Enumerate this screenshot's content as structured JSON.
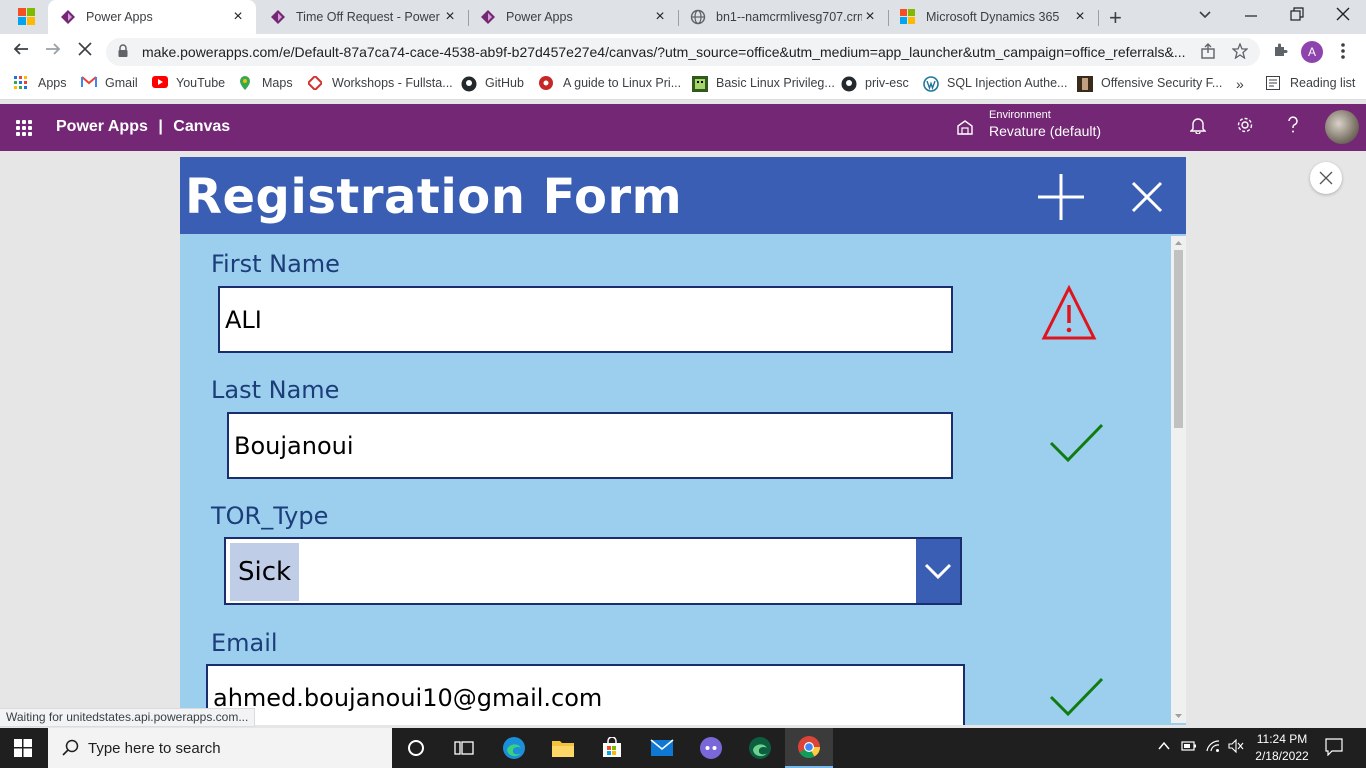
{
  "browser": {
    "tabs": [
      {
        "title": "Power Apps",
        "active": true
      },
      {
        "title": "Time Off Request - Power A",
        "active": false
      },
      {
        "title": "Power Apps",
        "active": false
      },
      {
        "title": "bn1--namcrmlivesg707.crm",
        "active": false
      },
      {
        "title": "Microsoft Dynamics 365",
        "active": false
      }
    ],
    "url": "make.powerapps.com/e/Default-87a7ca74-cace-4538-ab9f-b27d457e27e4/canvas/?utm_source=office&utm_medium=app_launcher&utm_campaign=office_referrals&...",
    "profile_initial": "A",
    "bookmarks": [
      "Apps",
      "Gmail",
      "YouTube",
      "Maps",
      "Workshops - Fullsta...",
      "GitHub",
      "A guide to Linux Pri...",
      "Basic Linux Privileg...",
      "priv-esc",
      "SQL Injection Authe...",
      "Offensive Security F..."
    ],
    "bookmarks_overflow": "»",
    "reading_list": "Reading list",
    "status_text": "Waiting for unitedstates.api.powerapps.com..."
  },
  "powerapps": {
    "brand": "Power Apps",
    "separator": "|",
    "mode": "Canvas",
    "environment_label": "Environment",
    "environment_name": "Revature (default)"
  },
  "form": {
    "title": "Registration Form",
    "fields": {
      "first_name": {
        "label": "First Name",
        "value": "ALI",
        "status": "warning"
      },
      "last_name": {
        "label": "Last Name",
        "value": "Boujanoui",
        "status": "valid"
      },
      "tor_type": {
        "label": "TOR_Type",
        "value": "Sick"
      },
      "email": {
        "label": "Email",
        "value": "ahmed.boujanoui10@gmail.com",
        "status": "valid"
      }
    }
  },
  "taskbar": {
    "search_placeholder": "Type here to search",
    "time": "11:24 PM",
    "date": "2/18/2022"
  },
  "colors": {
    "powerapps_purple": "#742774",
    "form_header": "#3a5eb3",
    "form_body": "#9bcfed",
    "label_text": "#1c3d7a",
    "warning_red": "#e0141e",
    "valid_green": "#107c10"
  },
  "icons": [
    "windows-logo",
    "powerapps-icon",
    "globe-icon",
    "ms365-icon",
    "plus-icon",
    "close-icon",
    "back-arrow-icon",
    "forward-arrow-icon",
    "reload-icon",
    "lock-icon",
    "share-icon",
    "star-icon",
    "extensions-icon",
    "waffle-icon",
    "environment-icon",
    "bell-icon",
    "gear-icon",
    "help-icon",
    "warning-icon",
    "checkmark-icon",
    "chevron-down-icon",
    "search-icon"
  ]
}
